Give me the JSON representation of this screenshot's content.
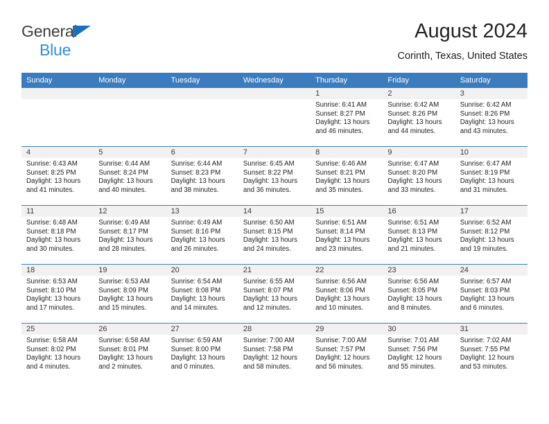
{
  "brand": {
    "name_part1": "General",
    "name_part2": "Blue",
    "triangle_color": "#1c6fba",
    "blue_color": "#2f8fd8"
  },
  "header": {
    "title": "August 2024",
    "subtitle": "Corinth, Texas, United States"
  },
  "theme": {
    "header_row_bg": "#3b7cbf",
    "date_strip_bg": "#f1f1f1",
    "row_divider": "#3b7cbf"
  },
  "weekdays": [
    "Sunday",
    "Monday",
    "Tuesday",
    "Wednesday",
    "Thursday",
    "Friday",
    "Saturday"
  ],
  "weeks": [
    [
      {
        "day": "",
        "sunrise": "",
        "sunset": "",
        "daylight_line1": "",
        "daylight_line2": ""
      },
      {
        "day": "",
        "sunrise": "",
        "sunset": "",
        "daylight_line1": "",
        "daylight_line2": ""
      },
      {
        "day": "",
        "sunrise": "",
        "sunset": "",
        "daylight_line1": "",
        "daylight_line2": ""
      },
      {
        "day": "",
        "sunrise": "",
        "sunset": "",
        "daylight_line1": "",
        "daylight_line2": ""
      },
      {
        "day": "1",
        "sunrise": "Sunrise: 6:41 AM",
        "sunset": "Sunset: 8:27 PM",
        "daylight_line1": "Daylight: 13 hours",
        "daylight_line2": "and 46 minutes."
      },
      {
        "day": "2",
        "sunrise": "Sunrise: 6:42 AM",
        "sunset": "Sunset: 8:26 PM",
        "daylight_line1": "Daylight: 13 hours",
        "daylight_line2": "and 44 minutes."
      },
      {
        "day": "3",
        "sunrise": "Sunrise: 6:42 AM",
        "sunset": "Sunset: 8:26 PM",
        "daylight_line1": "Daylight: 13 hours",
        "daylight_line2": "and 43 minutes."
      }
    ],
    [
      {
        "day": "4",
        "sunrise": "Sunrise: 6:43 AM",
        "sunset": "Sunset: 8:25 PM",
        "daylight_line1": "Daylight: 13 hours",
        "daylight_line2": "and 41 minutes."
      },
      {
        "day": "5",
        "sunrise": "Sunrise: 6:44 AM",
        "sunset": "Sunset: 8:24 PM",
        "daylight_line1": "Daylight: 13 hours",
        "daylight_line2": "and 40 minutes."
      },
      {
        "day": "6",
        "sunrise": "Sunrise: 6:44 AM",
        "sunset": "Sunset: 8:23 PM",
        "daylight_line1": "Daylight: 13 hours",
        "daylight_line2": "and 38 minutes."
      },
      {
        "day": "7",
        "sunrise": "Sunrise: 6:45 AM",
        "sunset": "Sunset: 8:22 PM",
        "daylight_line1": "Daylight: 13 hours",
        "daylight_line2": "and 36 minutes."
      },
      {
        "day": "8",
        "sunrise": "Sunrise: 6:46 AM",
        "sunset": "Sunset: 8:21 PM",
        "daylight_line1": "Daylight: 13 hours",
        "daylight_line2": "and 35 minutes."
      },
      {
        "day": "9",
        "sunrise": "Sunrise: 6:47 AM",
        "sunset": "Sunset: 8:20 PM",
        "daylight_line1": "Daylight: 13 hours",
        "daylight_line2": "and 33 minutes."
      },
      {
        "day": "10",
        "sunrise": "Sunrise: 6:47 AM",
        "sunset": "Sunset: 8:19 PM",
        "daylight_line1": "Daylight: 13 hours",
        "daylight_line2": "and 31 minutes."
      }
    ],
    [
      {
        "day": "11",
        "sunrise": "Sunrise: 6:48 AM",
        "sunset": "Sunset: 8:18 PM",
        "daylight_line1": "Daylight: 13 hours",
        "daylight_line2": "and 30 minutes."
      },
      {
        "day": "12",
        "sunrise": "Sunrise: 6:49 AM",
        "sunset": "Sunset: 8:17 PM",
        "daylight_line1": "Daylight: 13 hours",
        "daylight_line2": "and 28 minutes."
      },
      {
        "day": "13",
        "sunrise": "Sunrise: 6:49 AM",
        "sunset": "Sunset: 8:16 PM",
        "daylight_line1": "Daylight: 13 hours",
        "daylight_line2": "and 26 minutes."
      },
      {
        "day": "14",
        "sunrise": "Sunrise: 6:50 AM",
        "sunset": "Sunset: 8:15 PM",
        "daylight_line1": "Daylight: 13 hours",
        "daylight_line2": "and 24 minutes."
      },
      {
        "day": "15",
        "sunrise": "Sunrise: 6:51 AM",
        "sunset": "Sunset: 8:14 PM",
        "daylight_line1": "Daylight: 13 hours",
        "daylight_line2": "and 23 minutes."
      },
      {
        "day": "16",
        "sunrise": "Sunrise: 6:51 AM",
        "sunset": "Sunset: 8:13 PM",
        "daylight_line1": "Daylight: 13 hours",
        "daylight_line2": "and 21 minutes."
      },
      {
        "day": "17",
        "sunrise": "Sunrise: 6:52 AM",
        "sunset": "Sunset: 8:12 PM",
        "daylight_line1": "Daylight: 13 hours",
        "daylight_line2": "and 19 minutes."
      }
    ],
    [
      {
        "day": "18",
        "sunrise": "Sunrise: 6:53 AM",
        "sunset": "Sunset: 8:10 PM",
        "daylight_line1": "Daylight: 13 hours",
        "daylight_line2": "and 17 minutes."
      },
      {
        "day": "19",
        "sunrise": "Sunrise: 6:53 AM",
        "sunset": "Sunset: 8:09 PM",
        "daylight_line1": "Daylight: 13 hours",
        "daylight_line2": "and 15 minutes."
      },
      {
        "day": "20",
        "sunrise": "Sunrise: 6:54 AM",
        "sunset": "Sunset: 8:08 PM",
        "daylight_line1": "Daylight: 13 hours",
        "daylight_line2": "and 14 minutes."
      },
      {
        "day": "21",
        "sunrise": "Sunrise: 6:55 AM",
        "sunset": "Sunset: 8:07 PM",
        "daylight_line1": "Daylight: 13 hours",
        "daylight_line2": "and 12 minutes."
      },
      {
        "day": "22",
        "sunrise": "Sunrise: 6:56 AM",
        "sunset": "Sunset: 8:06 PM",
        "daylight_line1": "Daylight: 13 hours",
        "daylight_line2": "and 10 minutes."
      },
      {
        "day": "23",
        "sunrise": "Sunrise: 6:56 AM",
        "sunset": "Sunset: 8:05 PM",
        "daylight_line1": "Daylight: 13 hours",
        "daylight_line2": "and 8 minutes."
      },
      {
        "day": "24",
        "sunrise": "Sunrise: 6:57 AM",
        "sunset": "Sunset: 8:03 PM",
        "daylight_line1": "Daylight: 13 hours",
        "daylight_line2": "and 6 minutes."
      }
    ],
    [
      {
        "day": "25",
        "sunrise": "Sunrise: 6:58 AM",
        "sunset": "Sunset: 8:02 PM",
        "daylight_line1": "Daylight: 13 hours",
        "daylight_line2": "and 4 minutes."
      },
      {
        "day": "26",
        "sunrise": "Sunrise: 6:58 AM",
        "sunset": "Sunset: 8:01 PM",
        "daylight_line1": "Daylight: 13 hours",
        "daylight_line2": "and 2 minutes."
      },
      {
        "day": "27",
        "sunrise": "Sunrise: 6:59 AM",
        "sunset": "Sunset: 8:00 PM",
        "daylight_line1": "Daylight: 13 hours",
        "daylight_line2": "and 0 minutes."
      },
      {
        "day": "28",
        "sunrise": "Sunrise: 7:00 AM",
        "sunset": "Sunset: 7:58 PM",
        "daylight_line1": "Daylight: 12 hours",
        "daylight_line2": "and 58 minutes."
      },
      {
        "day": "29",
        "sunrise": "Sunrise: 7:00 AM",
        "sunset": "Sunset: 7:57 PM",
        "daylight_line1": "Daylight: 12 hours",
        "daylight_line2": "and 56 minutes."
      },
      {
        "day": "30",
        "sunrise": "Sunrise: 7:01 AM",
        "sunset": "Sunset: 7:56 PM",
        "daylight_line1": "Daylight: 12 hours",
        "daylight_line2": "and 55 minutes."
      },
      {
        "day": "31",
        "sunrise": "Sunrise: 7:02 AM",
        "sunset": "Sunset: 7:55 PM",
        "daylight_line1": "Daylight: 12 hours",
        "daylight_line2": "and 53 minutes."
      }
    ]
  ]
}
